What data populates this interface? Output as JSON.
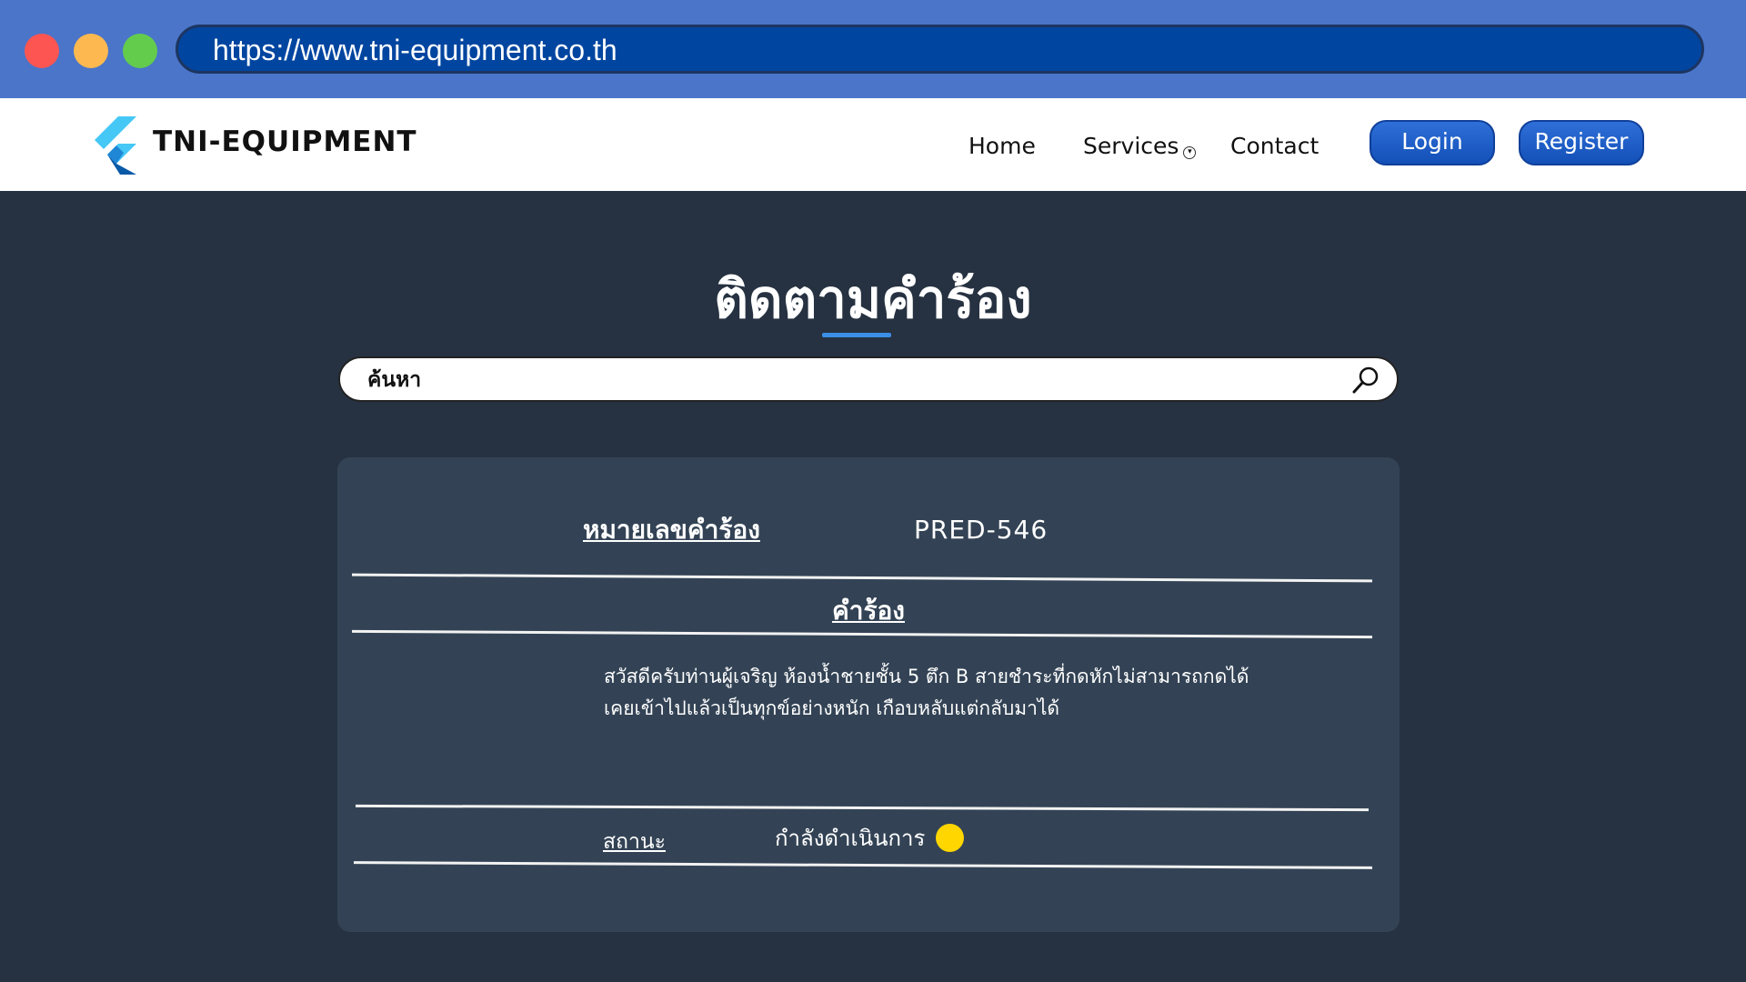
{
  "browser": {
    "url": "https://www.tni-equipment.co.th"
  },
  "header": {
    "brand": "TNI-EQUIPMENT",
    "nav": {
      "home": "Home",
      "services": "Services",
      "contact": "Contact"
    },
    "login_label": "Login",
    "register_label": "Register"
  },
  "main": {
    "title": "ติดตามคำร้อง",
    "search": {
      "placeholder": "ค้นหา",
      "value": ""
    },
    "card": {
      "request_number_label": "หมายเลขคำร้อง",
      "request_number": "PRED-546",
      "complaint_label": "คำร้อง",
      "complaint_text": "สวัสดีครับท่านผู้เจริญ ห้องน้ำชายชั้น 5 ตึก B สายชำระที่กดหักไม่สามารถกดได้ เคยเข้าไปแล้วเป็นทุกข์อย่างหนัก เกือบหลับแต่กลับมาได้",
      "status_label": "สถานะ",
      "status_value": "กำลังดำเนินการ",
      "status_color": "#ffd600"
    }
  },
  "colors": {
    "chrome": "#4a75c9",
    "url_bar": "#0045a0",
    "page_bg": "#263241",
    "card_bg": "#334355",
    "accent": "#3b8fe6",
    "button": "#1e5fc9"
  }
}
